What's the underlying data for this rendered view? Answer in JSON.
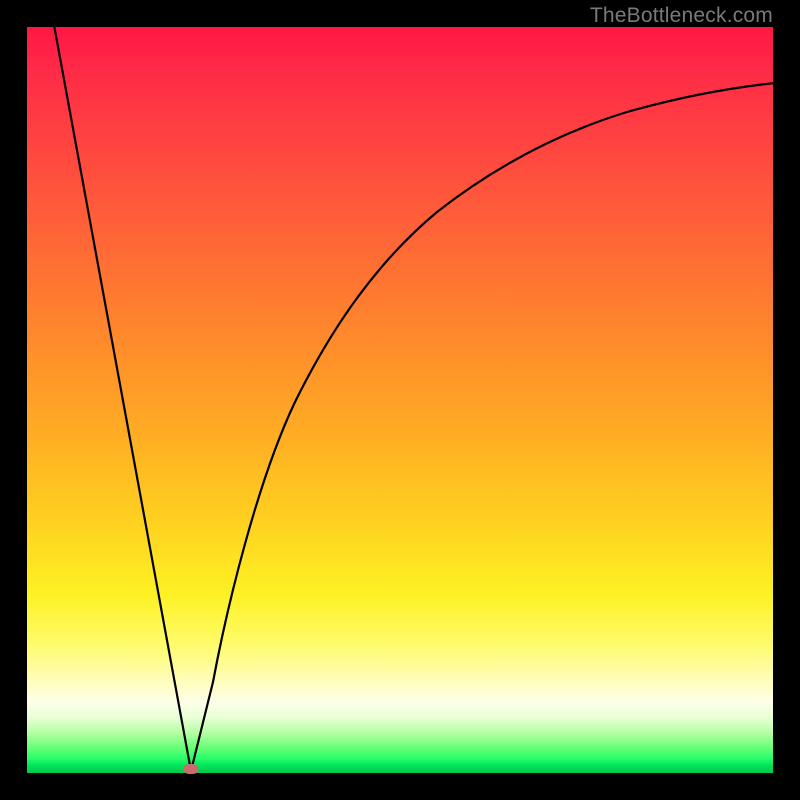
{
  "attribution": "TheBottleneck.com",
  "chart_data": {
    "type": "line",
    "title": "",
    "xlabel": "",
    "ylabel": "",
    "xlim": [
      0,
      100
    ],
    "ylim": [
      0,
      100
    ],
    "grid": false,
    "legend": false,
    "background_gradient": {
      "top_color": "#ff1744",
      "bottom_color": "#00c84a",
      "description": "vertical red-to-orange-to-yellow-to-green gradient"
    },
    "series": [
      {
        "name": "bottleneck-curve-left",
        "description": "steep descending line from top-left to minimum",
        "x": [
          3.6,
          22.0
        ],
        "y": [
          100,
          0
        ]
      },
      {
        "name": "bottleneck-curve-right",
        "description": "rising concave curve from minimum toward upper right",
        "x": [
          22.0,
          25,
          28,
          32,
          36,
          40,
          45,
          50,
          55,
          60,
          65,
          70,
          75,
          80,
          85,
          90,
          95,
          100
        ],
        "y": [
          0,
          12,
          24,
          36,
          46,
          53,
          61,
          67,
          72,
          76,
          79.5,
          82.3,
          84.6,
          86.5,
          88,
          89.3,
          90.3,
          91
        ]
      }
    ],
    "annotations": [
      {
        "name": "optimal-point-marker",
        "shape": "ellipse",
        "color": "#cc6b6b",
        "x": 22.0,
        "y": 0
      }
    ]
  }
}
